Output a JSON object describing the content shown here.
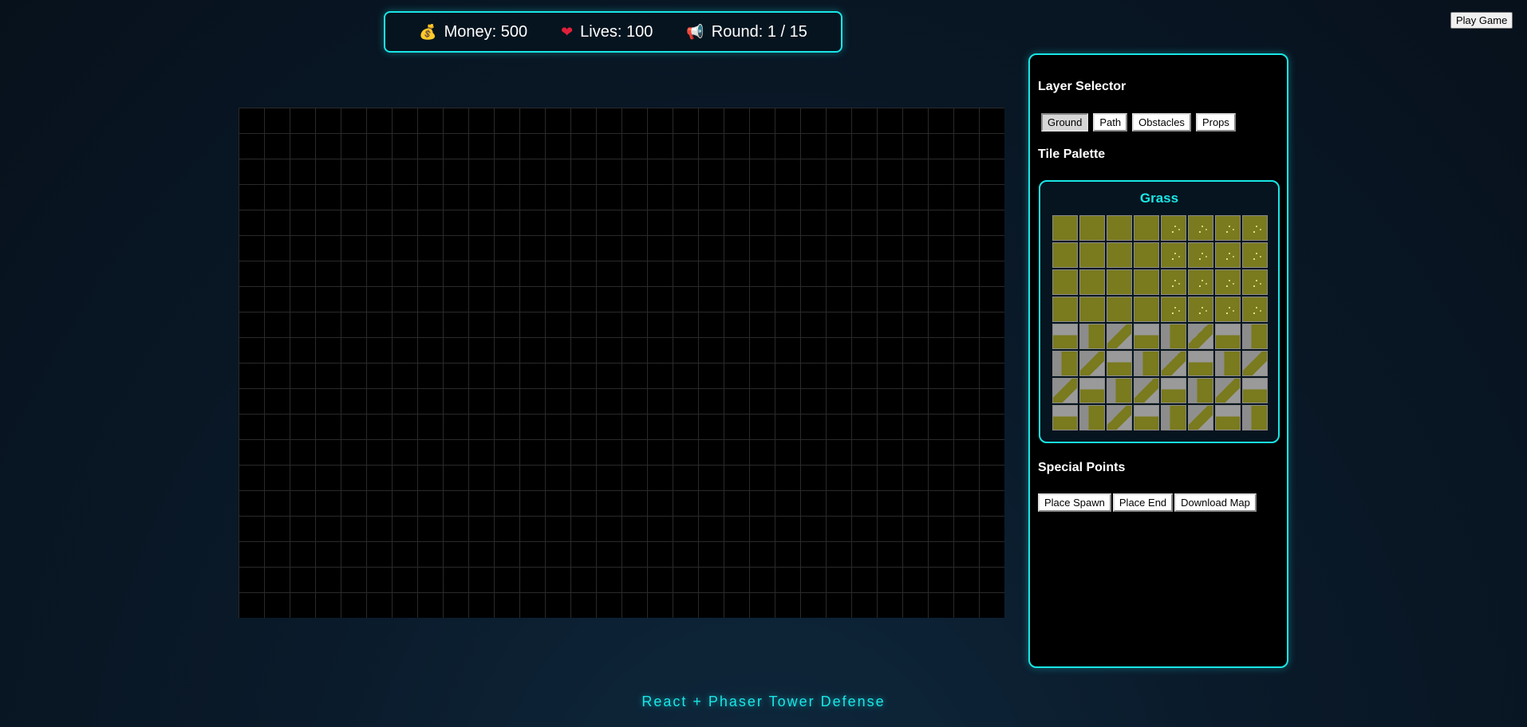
{
  "hud": {
    "money_icon": "money-bag-icon",
    "money_text": "Money: 500",
    "lives_icon": "heart-icon",
    "lives_text": "Lives: 100",
    "round_icon": "megaphone-icon",
    "round_text": "Round: 1 / 15"
  },
  "play_button_label": "Play Game",
  "panel": {
    "layer_title": "Layer Selector",
    "layers": [
      "Ground",
      "Path",
      "Obstacles",
      "Props"
    ],
    "active_layer": "Ground",
    "tile_palette_title": "Tile Palette",
    "palette_name": "Grass",
    "special_title": "Special Points",
    "buttons": {
      "spawn": "Place Spawn",
      "end": "Place End",
      "download": "Download Map"
    }
  },
  "colors": {
    "accent": "#19e6e6",
    "grass": "#7a7a1e",
    "stone": "#8f8f8f"
  },
  "footer_text": "React + Phaser Tower Defense"
}
